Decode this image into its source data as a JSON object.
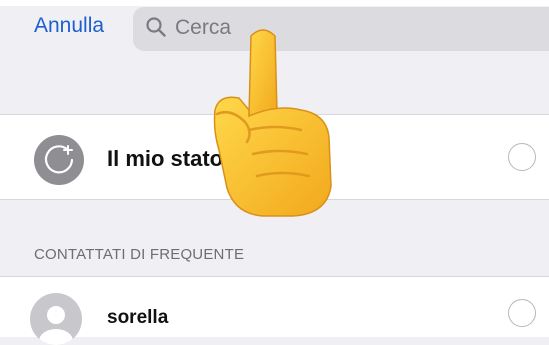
{
  "header": {
    "cancel_label": "Annulla",
    "search_placeholder": "Cerca",
    "accent_color": "#1d5fd1"
  },
  "status_row": {
    "label": "Il mio stato",
    "avatar_icon": "status-add-icon",
    "selected": false
  },
  "section": {
    "title": "CONTATTATI DI FREQUENTE"
  },
  "contacts": [
    {
      "name": "sorella",
      "avatar_icon": "person-icon",
      "selected": false
    }
  ],
  "overlay": {
    "icon": "pointing-hand-emoji"
  }
}
